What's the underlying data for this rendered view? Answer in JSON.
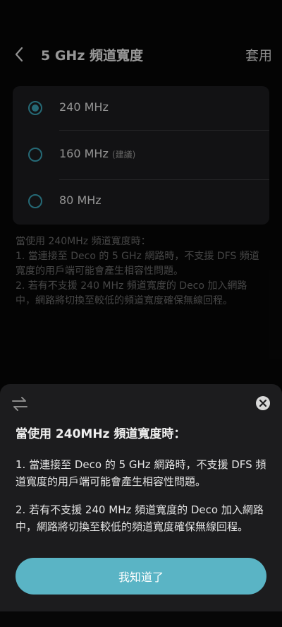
{
  "header": {
    "title": "5 GHz 頻道寬度",
    "apply_label": "套用"
  },
  "options": [
    {
      "label": "240 MHz",
      "hint": "",
      "selected": true
    },
    {
      "label": "160 MHz",
      "hint": "(建議)",
      "selected": false
    },
    {
      "label": "80 MHz",
      "hint": "",
      "selected": false
    }
  ],
  "info": {
    "heading": "當使用 240MHz 頻道寬度時：",
    "line1": "1. 當連接至 Deco 的 5 GHz 網路時，不支援 DFS 頻道寬度的用戶端可能會產生相容性問題。",
    "line2": "2. 若有不支援 240 MHz 頻道寬度的 Deco 加入網路中，網路將切換至較低的頻道寬度確保無線回程。"
  },
  "sheet": {
    "title": "當使用 240MHz 頻道寬度時：",
    "para1": "1. 當連接至 Deco 的 5 GHz 網路時，不支援 DFS 頻道寬度的用戶端可能會產生相容性問題。",
    "para2": "2. 若有不支援 240 MHz 頻道寬度的 Deco 加入網路中，網路將切換至較低的頻道寬度確保無線回程。",
    "ok_label": "我知道了"
  },
  "colors": {
    "accent": "#3aa2b5",
    "button": "#5ab4c5",
    "background": "#070707",
    "card": "#1d1d1f"
  }
}
